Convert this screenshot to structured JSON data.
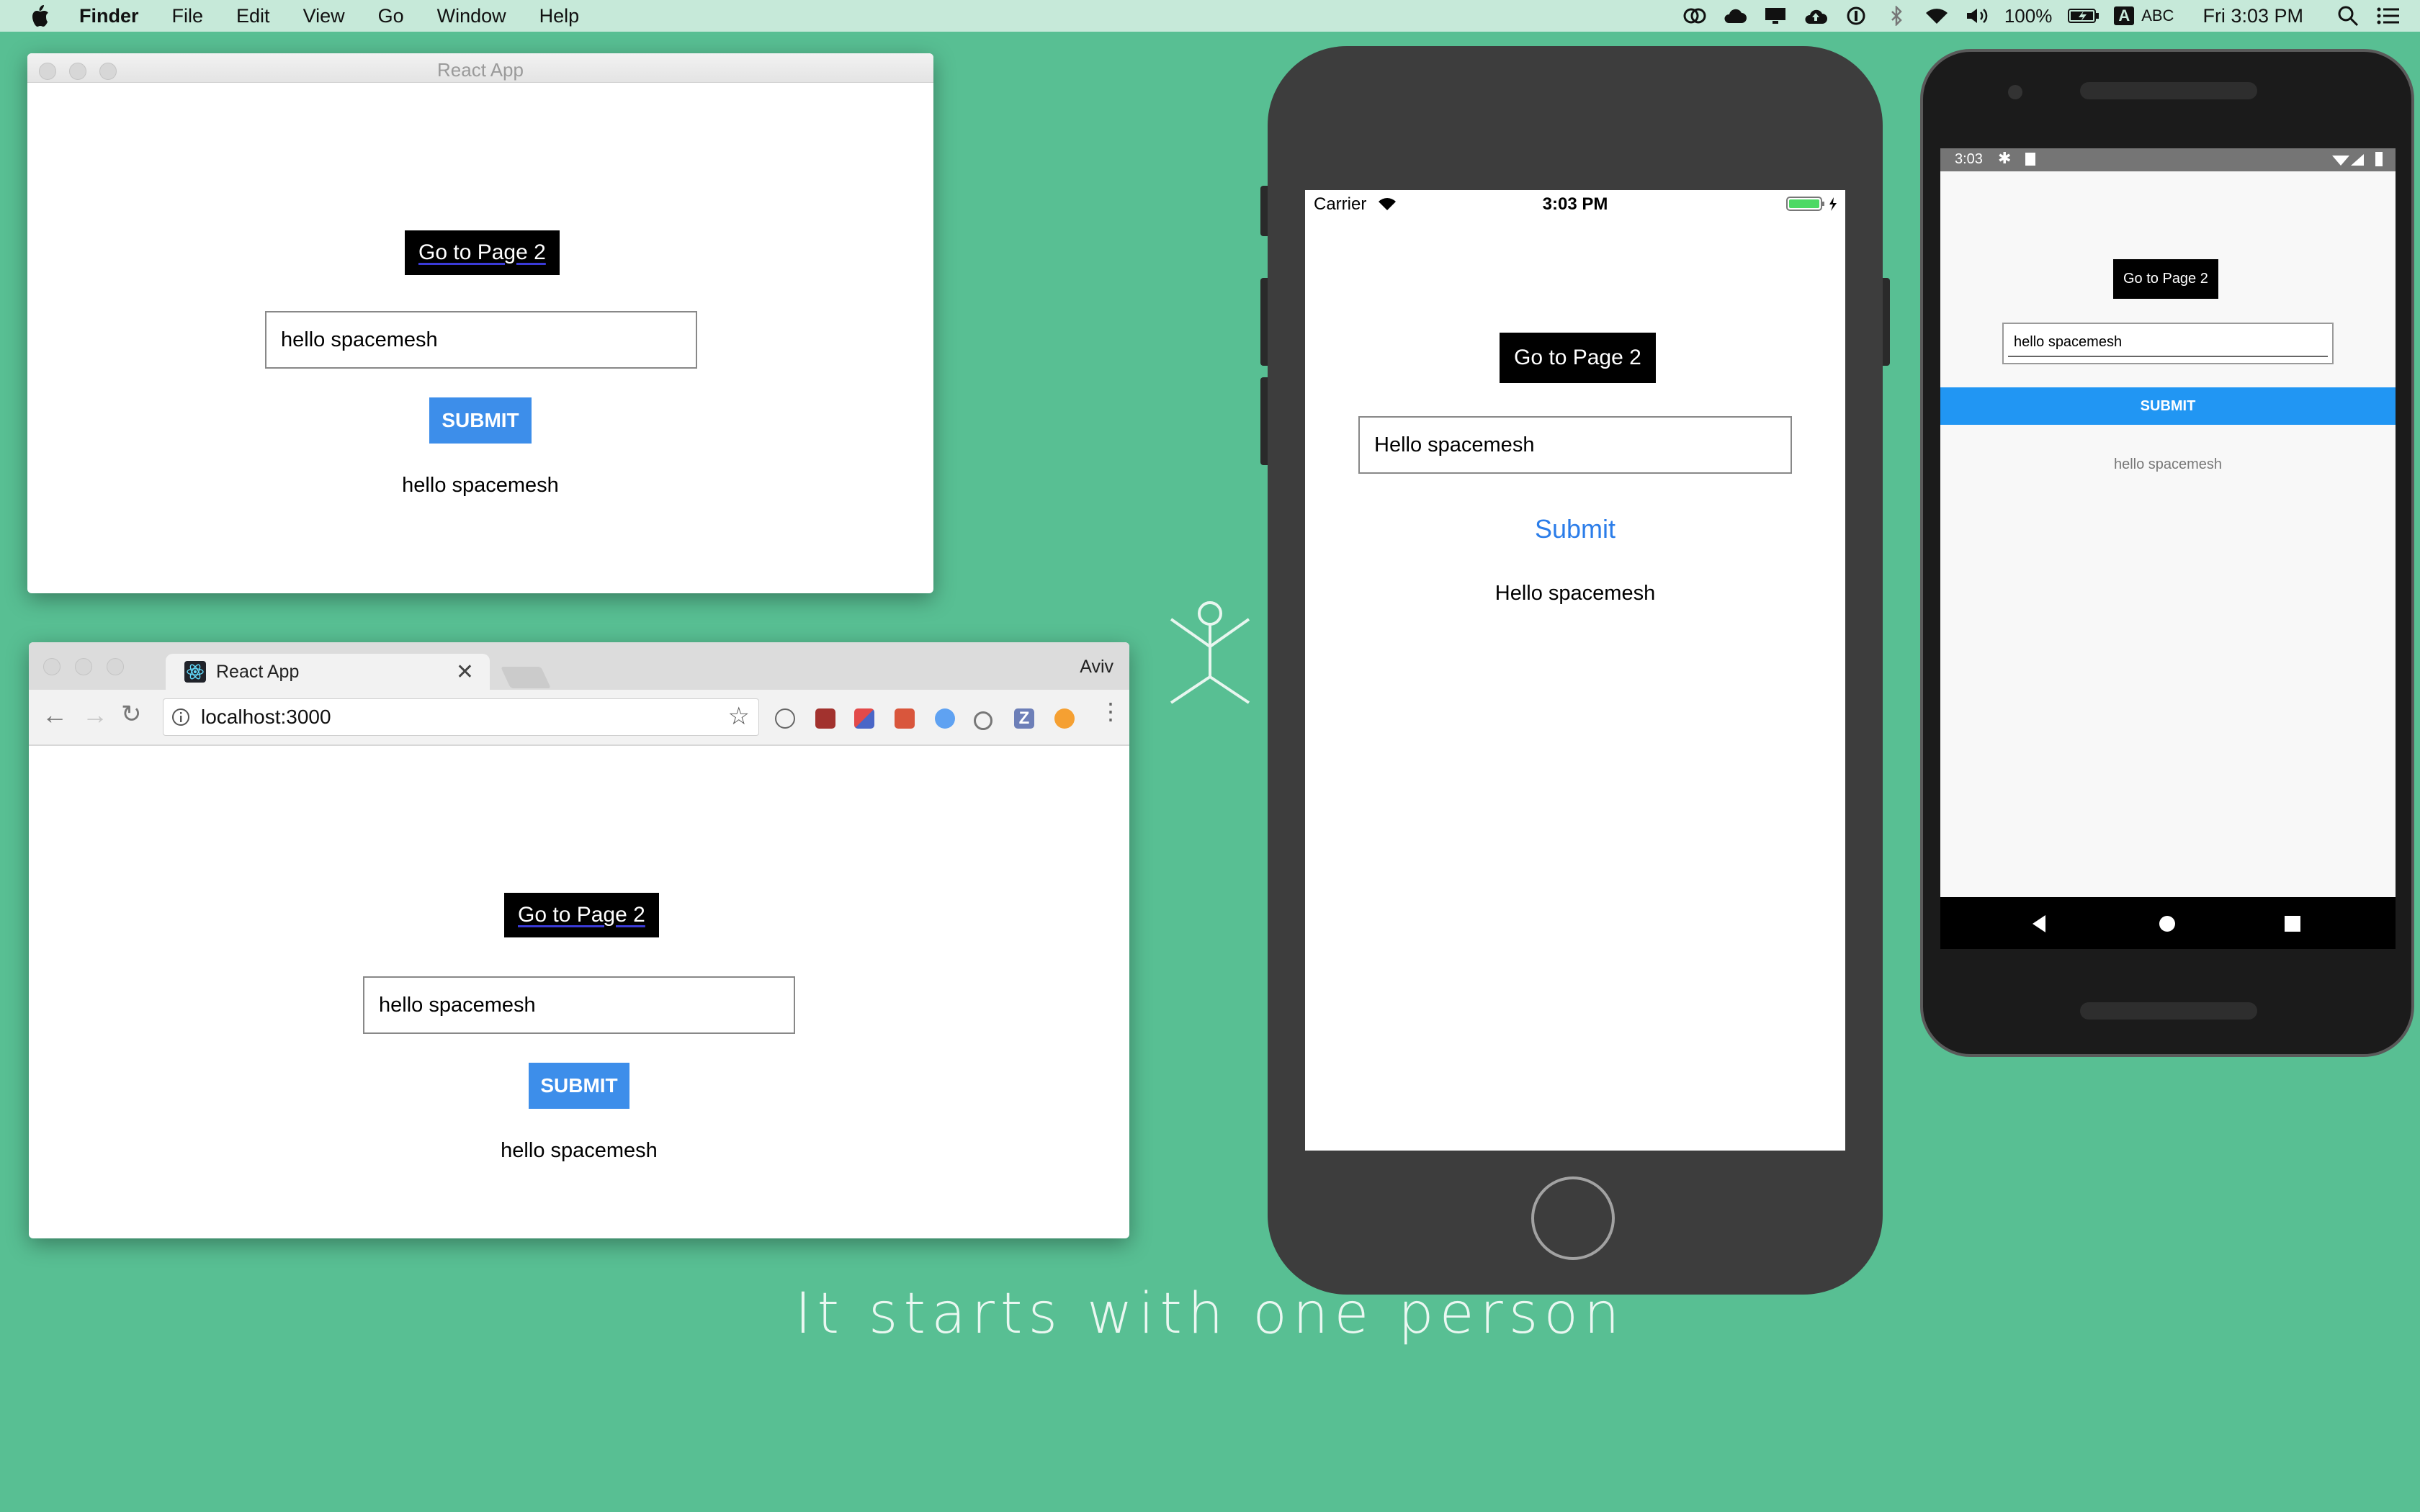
{
  "menubar": {
    "app_name": "Finder",
    "menus": [
      "File",
      "Edit",
      "View",
      "Go",
      "Window",
      "Help"
    ],
    "battery": "100%",
    "input_source": "ABC",
    "input_letter": "A",
    "clock": "Fri 3:03 PM",
    "icons": [
      "creative-cloud-icon",
      "cloud-icon",
      "display-icon",
      "upload-icon",
      "onepassword-icon",
      "bluetooth-icon",
      "wifi-icon",
      "volume-icon",
      "battery-icon",
      "search-icon",
      "list-icon"
    ]
  },
  "desktop_window": {
    "title": "React App",
    "goto_label": "Go to Page 2",
    "input_value": "hello spacemesh",
    "submit_label": "SUBMIT",
    "echo_text": "hello spacemesh"
  },
  "chrome_window": {
    "tab_title": "React App",
    "profile_name": "Aviv",
    "url": "localhost:3000",
    "goto_label": "Go to Page 2",
    "input_value": "hello spacemesh",
    "submit_label": "SUBMIT",
    "echo_text": "hello spacemesh"
  },
  "iphone": {
    "carrier": "Carrier",
    "time": "3:03 PM",
    "goto_label": "Go to Page 2",
    "input_value": "Hello spacemesh",
    "submit_label": "Submit",
    "echo_text": "Hello spacemesh"
  },
  "android": {
    "time": "3:03",
    "goto_label": "Go to Page 2",
    "input_value": "hello spacemesh",
    "submit_label": "SUBMIT",
    "echo_text": "hello spacemesh"
  },
  "tagline": "It starts with one person",
  "colors": {
    "background": "#58bf93",
    "web_submit": "#3d8eea",
    "ios_link": "#2b7de9",
    "android_submit": "#2196f3"
  }
}
